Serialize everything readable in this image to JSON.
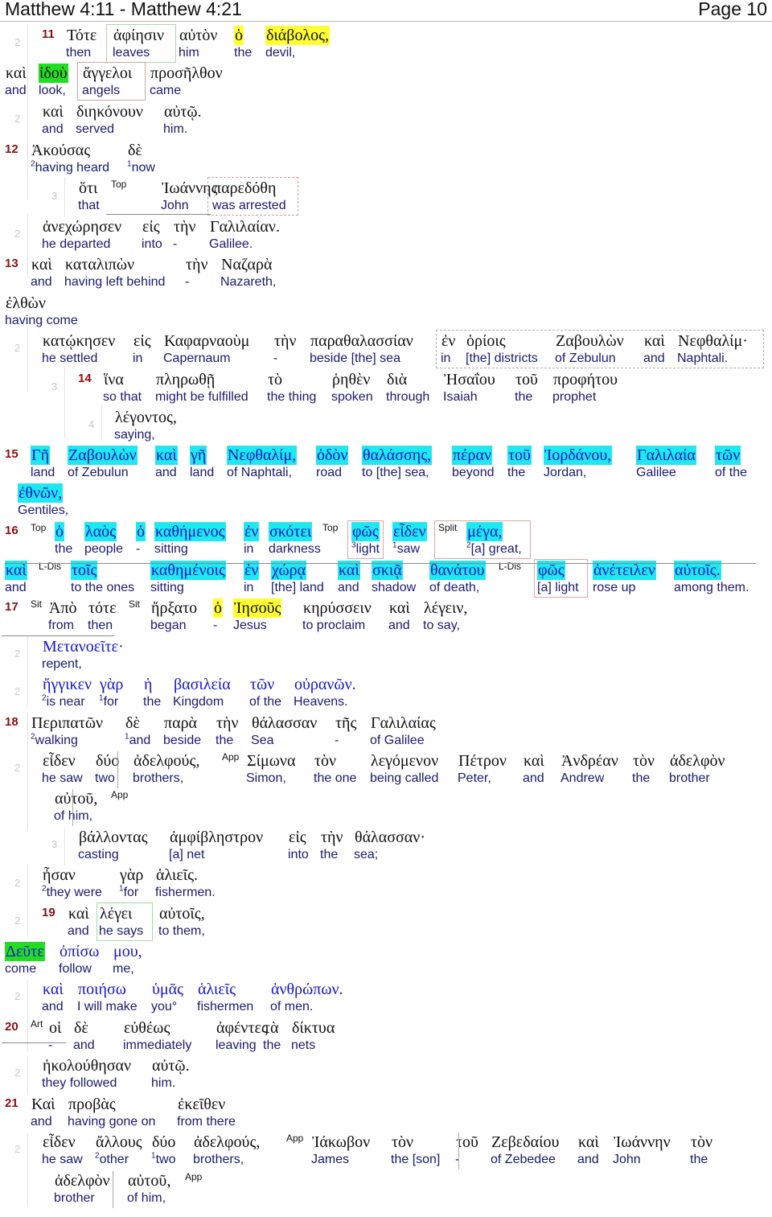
{
  "header": {
    "title": "Matthew 4:11 - Matthew 4:21",
    "page": "Page 10"
  },
  "colors": {
    "verse_number": "#8a1010",
    "english": "#1a1a6e",
    "greek_quote": "#1616c8",
    "highlight_yellow": "#ffff33",
    "highlight_green": "#22dd22",
    "highlight_cyan": "#1fe8f0",
    "level_number": "#c8c8c8"
  },
  "verses": {
    "v11": {
      "num": "11"
    },
    "v12": {
      "num": "12"
    },
    "v13": {
      "num": "13"
    },
    "v14": {
      "num": "14"
    },
    "v15": {
      "num": "15"
    },
    "v16": {
      "num": "16"
    },
    "v17": {
      "num": "17"
    },
    "v18": {
      "num": "18"
    },
    "v19": {
      "num": "19"
    },
    "v20": {
      "num": "20"
    },
    "v21": {
      "num": "21"
    }
  },
  "levels": {
    "two": "2",
    "three": "3",
    "four": "4"
  },
  "tags": {
    "top": "Top",
    "split": "Split",
    "ldis": "L-Dis",
    "sit": "Sit",
    "app": "App",
    "art": "Art"
  },
  "words": [
    {
      "g": "Τότε",
      "e": "then"
    },
    {
      "g": "ἀφίησιν",
      "e": "leaves"
    },
    {
      "g": "αὐτὸν",
      "e": "him"
    },
    {
      "g": "ὁ",
      "e": "the"
    },
    {
      "g": "διάβολος,",
      "e": "devil,"
    },
    {
      "g": "καὶ",
      "e": "and"
    },
    {
      "g": "ἰδοὺ",
      "e": "look,"
    },
    {
      "g": "ἄγγελοι",
      "e": "angels"
    },
    {
      "g": "προσῆλθον",
      "e": "came"
    },
    {
      "g": "καὶ",
      "e": "and"
    },
    {
      "g": "διηκόνουν",
      "e": "served"
    },
    {
      "g": "αὐτῷ.",
      "e": "him."
    },
    {
      "g": "Ἀκούσας",
      "e": "having heard",
      "sup": "2"
    },
    {
      "g": "δὲ",
      "e": "now",
      "sup": "1"
    },
    {
      "g": "ὅτι",
      "e": "that"
    },
    {
      "g": "Ἰωάννης",
      "e": "John"
    },
    {
      "g": "παρεδόθη",
      "e": "was arrested"
    },
    {
      "g": "ἀνεχώρησεν",
      "e": "he departed"
    },
    {
      "g": "εἰς",
      "e": "into"
    },
    {
      "g": "τὴν",
      "e": "-"
    },
    {
      "g": "Γαλιλαίαν.",
      "e": "Galilee."
    },
    {
      "g": "καὶ",
      "e": "and"
    },
    {
      "g": "καταλιπὼν",
      "e": "having left behind"
    },
    {
      "g": "τὴν",
      "e": "-"
    },
    {
      "g": "Ναζαρὰ",
      "e": "Nazareth,"
    },
    {
      "g": "ἐλθὼν",
      "e": "having come"
    },
    {
      "g": "κατῴκησεν",
      "e": "he settled"
    },
    {
      "g": "εἰς",
      "e": "in"
    },
    {
      "g": "Καφαρναοὺμ",
      "e": "Capernaum"
    },
    {
      "g": "τὴν",
      "e": "-"
    },
    {
      "g": "παραθαλασσίαν",
      "e": "beside [the] sea"
    },
    {
      "g": "ἐν",
      "e": "in"
    },
    {
      "g": "ὁρίοις",
      "e": "[the] districts"
    },
    {
      "g": "Ζαβουλὼν",
      "e": "of Zebulun"
    },
    {
      "g": "καὶ",
      "e": "and"
    },
    {
      "g": "Νεφθαλίμ·",
      "e": "Naphtali."
    },
    {
      "g": "ἵνα",
      "e": "so that"
    },
    {
      "g": "πληρωθῇ",
      "e": "might be fulfilled"
    },
    {
      "g": "τὸ",
      "e": "the thing"
    },
    {
      "g": "ῥηθὲν",
      "e": "spoken"
    },
    {
      "g": "διὰ",
      "e": "through"
    },
    {
      "g": "Ἠσαΐου",
      "e": "Isaiah"
    },
    {
      "g": "τοῦ",
      "e": "the"
    },
    {
      "g": "προφήτου",
      "e": "prophet"
    },
    {
      "g": "λέγοντος,",
      "e": "saying,"
    },
    {
      "g": "Γῆ",
      "e": "land"
    },
    {
      "g": "Ζαβουλὼν",
      "e": "of Zebulun"
    },
    {
      "g": "καὶ",
      "e": "and"
    },
    {
      "g": "γῆ",
      "e": "land"
    },
    {
      "g": "Νεφθαλίμ,",
      "e": "of Naphtali,"
    },
    {
      "g": "ὁδὸν",
      "e": "road"
    },
    {
      "g": "θαλάσσης,",
      "e": "to [the] sea,"
    },
    {
      "g": "πέραν",
      "e": "beyond"
    },
    {
      "g": "τοῦ",
      "e": "the"
    },
    {
      "g": "Ἰορδάνου,",
      "e": "Jordan,"
    },
    {
      "g": "Γαλιλαία",
      "e": "Galilee"
    },
    {
      "g": "τῶν",
      "e": "of the"
    },
    {
      "g": "ἐθνῶν,",
      "e": "Gentiles,"
    },
    {
      "g": "ὁ",
      "e": "the"
    },
    {
      "g": "λαὸς",
      "e": "people"
    },
    {
      "g": "ὁ",
      "e": "-"
    },
    {
      "g": "καθήμενος",
      "e": "sitting"
    },
    {
      "g": "ἐν",
      "e": "in"
    },
    {
      "g": "σκότει",
      "e": "darkness"
    },
    {
      "g": "φῶς",
      "e": "light",
      "sup": "3"
    },
    {
      "g": "εἶδεν",
      "e": "saw",
      "sup": "1"
    },
    {
      "g": "μέγα,",
      "e": "[a] great,",
      "sup": "2"
    },
    {
      "g": "καὶ",
      "e": "and"
    },
    {
      "g": "τοῖς",
      "e": "to the ones"
    },
    {
      "g": "καθημένοις",
      "e": "sitting"
    },
    {
      "g": "ἐν",
      "e": "in"
    },
    {
      "g": "χώρᾳ",
      "e": "[the] land"
    },
    {
      "g": "καὶ",
      "e": "and"
    },
    {
      "g": "σκιᾷ",
      "e": "shadow"
    },
    {
      "g": "θανάτου",
      "e": "of death,"
    },
    {
      "g": "φῶς",
      "e": "[a] light"
    },
    {
      "g": "ἀνέτειλεν",
      "e": "rose up"
    },
    {
      "g": "αὐτοῖς.",
      "e": "among them."
    },
    {
      "g": "Ἀπὸ",
      "e": "from"
    },
    {
      "g": "τότε",
      "e": "then"
    },
    {
      "g": "ἤρξατο",
      "e": "began"
    },
    {
      "g": "ὁ",
      "e": "-"
    },
    {
      "g": "Ἰησοῦς",
      "e": "Jesus"
    },
    {
      "g": "κηρύσσειν",
      "e": "to proclaim"
    },
    {
      "g": "καὶ",
      "e": "and"
    },
    {
      "g": "λέγειν,",
      "e": "to say,"
    },
    {
      "g": "Μετανοεῖτε·",
      "e": "repent,"
    },
    {
      "g": "ἤγγικεν",
      "e": "is near",
      "sup": "2"
    },
    {
      "g": "γὰρ",
      "e": "for",
      "sup": "1"
    },
    {
      "g": "ἡ",
      "e": "the"
    },
    {
      "g": "βασιλεία",
      "e": "Kingdom"
    },
    {
      "g": "τῶν",
      "e": "of the"
    },
    {
      "g": "οὐρανῶν.",
      "e": "Heavens."
    },
    {
      "g": "Περιπατῶν",
      "e": "walking",
      "sup": "2"
    },
    {
      "g": "δὲ",
      "e": "and",
      "sup": "1"
    },
    {
      "g": "παρὰ",
      "e": "beside"
    },
    {
      "g": "τὴν",
      "e": "the"
    },
    {
      "g": "θάλασσαν",
      "e": "Sea"
    },
    {
      "g": "τῆς",
      "e": "-"
    },
    {
      "g": "Γαλιλαίας",
      "e": "of Galilee"
    },
    {
      "g": "εἶδεν",
      "e": "he saw"
    },
    {
      "g": "δύο",
      "e": "two"
    },
    {
      "g": "ἀδελφούς,",
      "e": "brothers,"
    },
    {
      "g": "Σίμωνα",
      "e": "Simon,"
    },
    {
      "g": "τὸν",
      "e": "the one"
    },
    {
      "g": "λεγόμενον",
      "e": "being called"
    },
    {
      "g": "Πέτρον",
      "e": "Peter,"
    },
    {
      "g": "καὶ",
      "e": "and"
    },
    {
      "g": "Ἀνδρέαν",
      "e": "Andrew"
    },
    {
      "g": "τὸν",
      "e": "the"
    },
    {
      "g": "ἀδελφὸν",
      "e": "brother"
    },
    {
      "g": "αὐτοῦ,",
      "e": "of him,"
    },
    {
      "g": "βάλλοντας",
      "e": "casting"
    },
    {
      "g": "ἀμφίβληστρον",
      "e": "[a] net"
    },
    {
      "g": "εἰς",
      "e": "into"
    },
    {
      "g": "τὴν",
      "e": "the"
    },
    {
      "g": "θάλασσαν·",
      "e": "sea;"
    },
    {
      "g": "ἦσαν",
      "e": "they were",
      "sup": "2"
    },
    {
      "g": "γὰρ",
      "e": "for",
      "sup": "1"
    },
    {
      "g": "ἁλιεῖς.",
      "e": "fishermen."
    },
    {
      "g": "καὶ",
      "e": "and"
    },
    {
      "g": "λέγει",
      "e": "he says"
    },
    {
      "g": "αὐτοῖς,",
      "e": "to them,"
    },
    {
      "g": "Δεῦτε",
      "e": "come"
    },
    {
      "g": "ὀπίσω",
      "e": "follow"
    },
    {
      "g": "μου,",
      "e": "me,"
    },
    {
      "g": "καὶ",
      "e": "and"
    },
    {
      "g": "ποιήσω",
      "e": "I will make"
    },
    {
      "g": "ὑμᾶς",
      "e": "you°"
    },
    {
      "g": "ἁλιεῖς",
      "e": "fishermen"
    },
    {
      "g": "ἀνθρώπων.",
      "e": "of men."
    },
    {
      "g": "οἱ",
      "e": "-"
    },
    {
      "g": "δὲ",
      "e": "and"
    },
    {
      "g": "εὐθέως",
      "e": "immediately"
    },
    {
      "g": "ἀφέντες",
      "e": "leaving"
    },
    {
      "g": "τὰ",
      "e": "the"
    },
    {
      "g": "δίκτυα",
      "e": "nets"
    },
    {
      "g": "ἠκολούθησαν",
      "e": "they followed"
    },
    {
      "g": "αὐτῷ.",
      "e": "him."
    },
    {
      "g": "Καὶ",
      "e": "and"
    },
    {
      "g": "προβὰς",
      "e": "having gone on"
    },
    {
      "g": "ἐκεῖθεν",
      "e": "from there"
    },
    {
      "g": "εἶδεν",
      "e": "he saw"
    },
    {
      "g": "ἄλλους",
      "e": "other",
      "sup": "2"
    },
    {
      "g": "δύο",
      "e": "two",
      "sup": "1"
    },
    {
      "g": "ἀδελφούς,",
      "e": "brothers,"
    },
    {
      "g": "Ἰάκωβον",
      "e": "James"
    },
    {
      "g": "τὸν",
      "e": "the [son]"
    },
    {
      "g": "τοῦ",
      "e": "-"
    },
    {
      "g": "Ζεβεδαίου",
      "e": "of Zebedee"
    },
    {
      "g": "καὶ",
      "e": "and"
    },
    {
      "g": "Ἰωάννην",
      "e": "John"
    },
    {
      "g": "τὸν",
      "e": "the"
    },
    {
      "g": "ἀδελφὸν",
      "e": "brother"
    },
    {
      "g": "αὐτοῦ,",
      "e": "of him,"
    }
  ]
}
